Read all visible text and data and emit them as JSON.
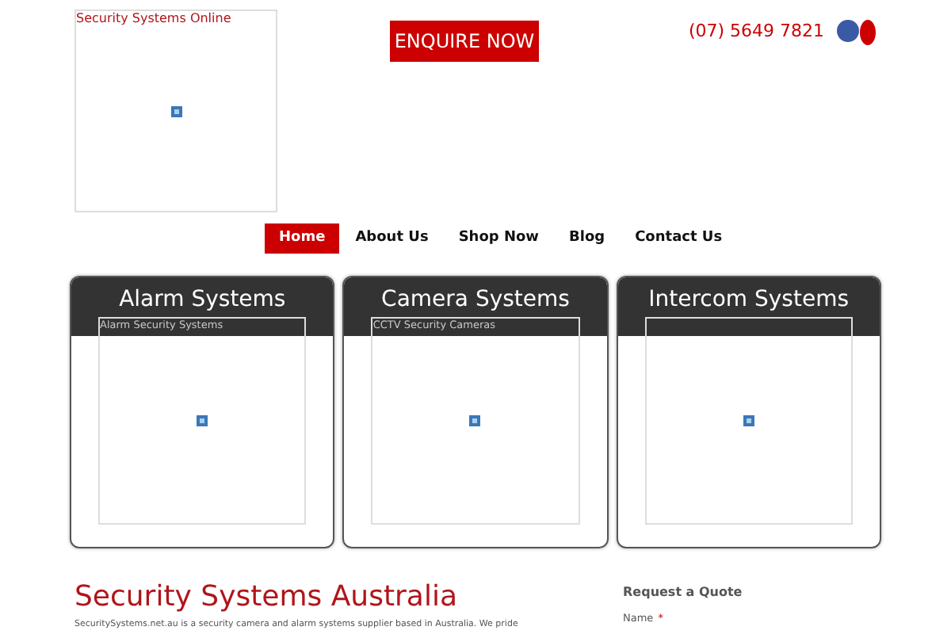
{
  "header": {
    "logo_alt": "Security Systems Online",
    "enquire_button": "ENQUIRE NOW",
    "phone": "(07) 5649 7821"
  },
  "nav": [
    {
      "label": "Home",
      "selected": true
    },
    {
      "label": "About Us",
      "selected": false
    },
    {
      "label": "Shop Now",
      "selected": false
    },
    {
      "label": "Blog",
      "selected": false
    },
    {
      "label": "Contact Us",
      "selected": false
    }
  ],
  "cards": [
    {
      "title": "Alarm Systems",
      "image_alt": "Alarm Security Systems"
    },
    {
      "title": "Camera Systems",
      "image_alt": "CCTV Security Cameras"
    },
    {
      "title": "Intercom Systems"
    }
  ],
  "main": {
    "heading": "Security Systems Australia",
    "intro": "SecuritySystems.net.au is a security camera and alarm systems supplier based in Australia. We pride"
  },
  "quote_form": {
    "title": "Request a Quote",
    "name_label": "Name",
    "required_mark": "*"
  }
}
